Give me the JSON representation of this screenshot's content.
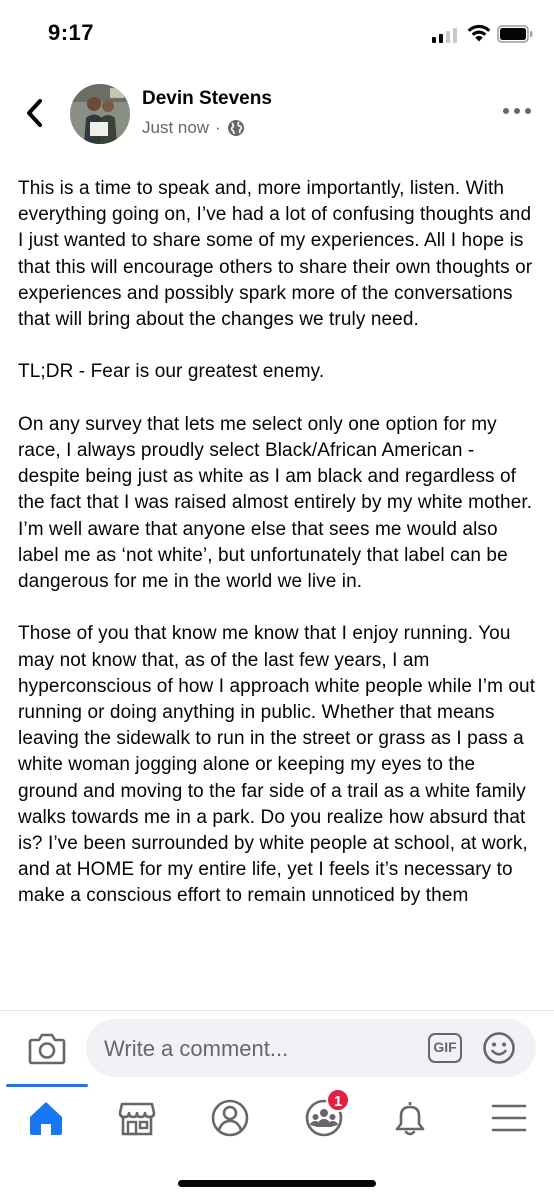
{
  "status_bar": {
    "time": "9:17",
    "signal_icon": "signal-icon",
    "wifi_icon": "wifi-icon",
    "battery_icon": "battery-icon"
  },
  "post": {
    "author": "Devin Stevens",
    "timestamp": "Just now",
    "separator": "·",
    "audience_icon": "globe-icon",
    "paragraphs": [
      "This is a time to speak and, more importantly, listen. With everything going on, I’ve had a lot of confusing thoughts and I just wanted to share some of my experiences. All I hope is that this will encourage others to share their own thoughts or experiences and possibly spark more of the conversations that will bring about the changes we truly need.",
      "TL;DR - Fear is our greatest enemy.",
      "On any survey that lets me select only one option for my race, I always proudly select Black/African American - despite being just as white as I am black and regardless of the fact that I was raised almost entirely by my white mother. I’m well aware that anyone else that sees me would also label me as ‘not white’, but unfortunately that label can be dangerous for me in the world we live in.",
      "Those of you that know me know that I enjoy running. You may not know that, as of the last few years, I am hyperconscious of how I approach white people while I’m out running or doing anything in public. Whether that means leaving the sidewalk to run in the street or grass as I pass a white woman jogging alone or keeping my eyes to the ground and moving to the far side of a trail as a white family walks towards me in a park. Do you realize how absurd that is? I’ve been surrounded by white people at school, at work, and at HOME for my entire life, yet I feels it’s necessary to make a conscious effort to remain unnoticed by them"
    ]
  },
  "comment_bar": {
    "placeholder": "Write a comment...",
    "gif_label": "GIF"
  },
  "tab_bar": {
    "active": "home",
    "groups_badge": "1",
    "colors": {
      "accent": "#1877f2",
      "badge": "#e41e3f",
      "icon": "#65676b"
    }
  }
}
